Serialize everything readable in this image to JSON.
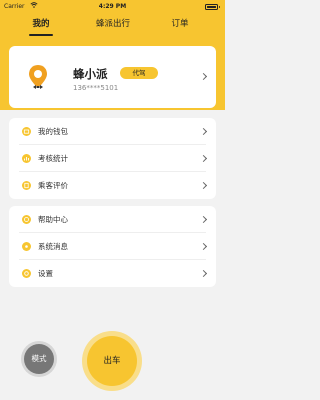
{
  "status_bar": {
    "carrier": "Carrier",
    "time": "4:29 PM"
  },
  "tabs": [
    {
      "label": "我的",
      "active": true
    },
    {
      "label": "蜂派出行",
      "active": false
    },
    {
      "label": "订单",
      "active": false
    }
  ],
  "profile": {
    "name": "蜂小派",
    "badge": "代驾",
    "phone": "136****5101"
  },
  "menu_group_1": [
    {
      "label": "我的钱包",
      "icon": "wallet-icon"
    },
    {
      "label": "考核统计",
      "icon": "stats-icon"
    },
    {
      "label": "乘客评价",
      "icon": "review-icon"
    }
  ],
  "menu_group_2": [
    {
      "label": "帮助中心",
      "icon": "help-icon"
    },
    {
      "label": "系统消息",
      "icon": "message-icon"
    },
    {
      "label": "设置",
      "icon": "settings-icon"
    }
  ],
  "buttons": {
    "mode": "模式",
    "go": "出车"
  },
  "colors": {
    "accent": "#f7c530",
    "accent_light": "#f9de8a",
    "mode_gray": "#777777"
  }
}
